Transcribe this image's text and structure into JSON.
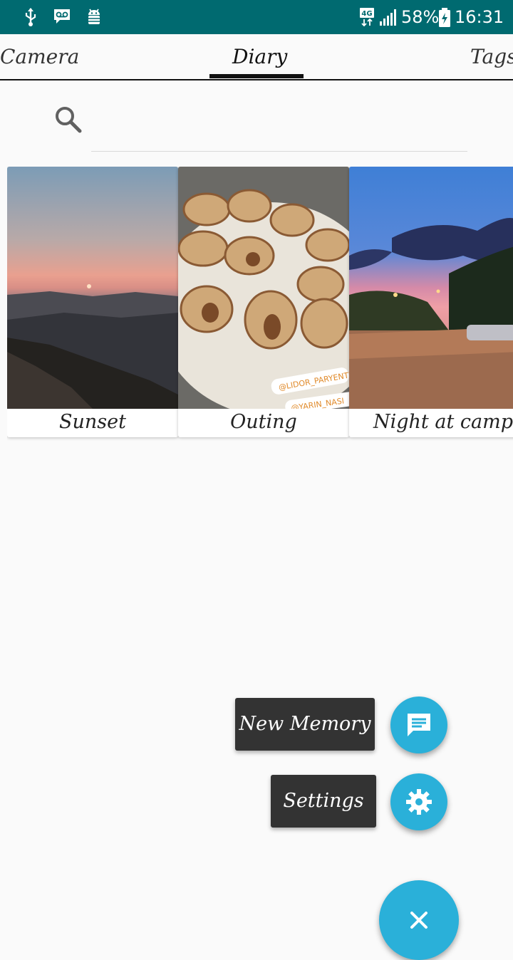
{
  "status_bar": {
    "network": "4G",
    "battery": "58%",
    "time": "16:31",
    "icons": [
      "usb-icon",
      "voicemail-icon",
      "android-debug-icon",
      "network-4g-icon",
      "signal-icon",
      "battery-icon"
    ]
  },
  "tabs": [
    {
      "label": "Camera",
      "selected": false
    },
    {
      "label": "Diary",
      "selected": true
    },
    {
      "label": "Tags",
      "selected": false
    }
  ],
  "search": {
    "value": "",
    "placeholder": ""
  },
  "cards": [
    {
      "caption": "Sunset"
    },
    {
      "caption": "Outing"
    },
    {
      "caption": "Night at campu"
    }
  ],
  "fab_menu": {
    "new_memory_label": "New Memory",
    "settings_label": "Settings"
  },
  "colors": {
    "status_bar": "#006a70",
    "accent": "#2ab0d9",
    "label_bg": "#333333",
    "background": "#fafafa"
  }
}
